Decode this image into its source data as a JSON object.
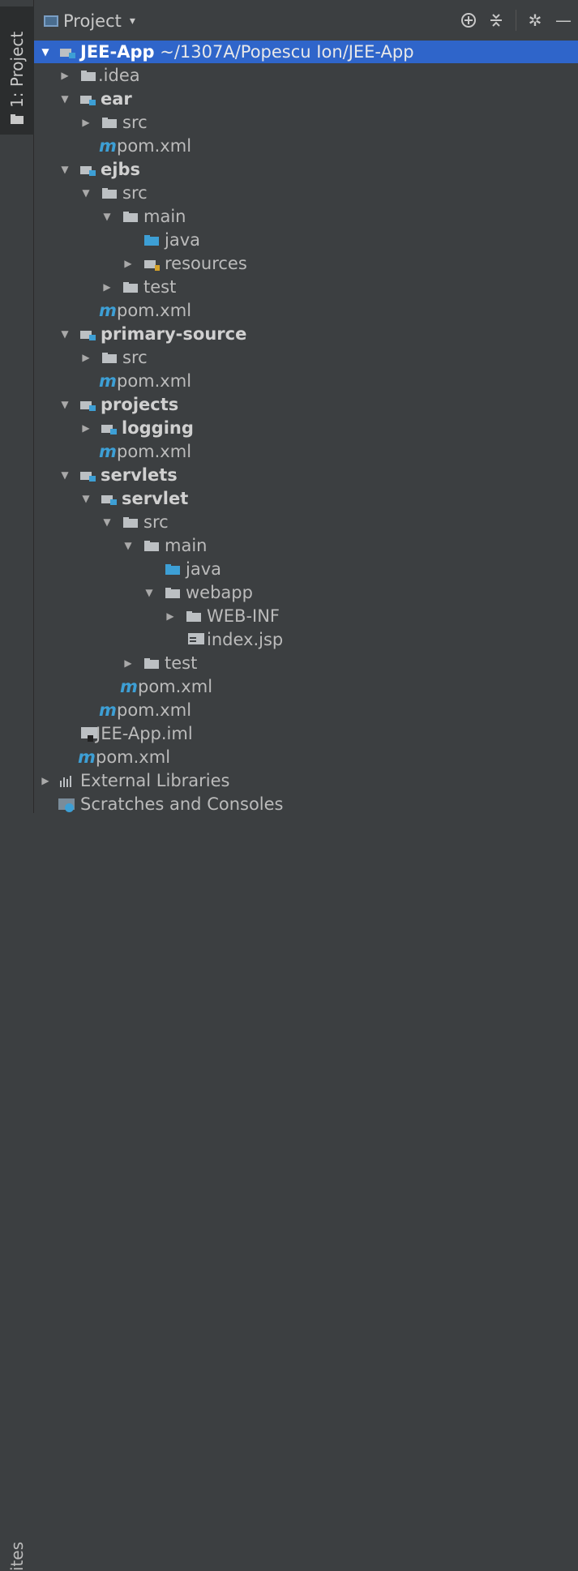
{
  "side": {
    "tab_label": "1: Project",
    "bottom_label": "ites"
  },
  "header": {
    "view_label": "Project",
    "icons": [
      "target-icon",
      "collapse-icon",
      "gear-icon",
      "minimize-icon"
    ]
  },
  "tree": {
    "root_name": "JEE-App",
    "root_path": "~/1307A/Popescu Ion/JEE-App",
    "items": [
      {
        "label": ".idea"
      },
      {
        "label": "ear"
      },
      {
        "label": "src"
      },
      {
        "label": "pom.xml"
      },
      {
        "label": "ejbs"
      },
      {
        "label": "src"
      },
      {
        "label": "main"
      },
      {
        "label": "java"
      },
      {
        "label": "resources"
      },
      {
        "label": "test"
      },
      {
        "label": "pom.xml"
      },
      {
        "label": "primary-source"
      },
      {
        "label": "src"
      },
      {
        "label": "pom.xml"
      },
      {
        "label": "projects"
      },
      {
        "label": "logging"
      },
      {
        "label": "pom.xml"
      },
      {
        "label": "servlets"
      },
      {
        "label": "servlet"
      },
      {
        "label": "src"
      },
      {
        "label": "main"
      },
      {
        "label": "java"
      },
      {
        "label": "webapp"
      },
      {
        "label": "WEB-INF"
      },
      {
        "label": "index.jsp"
      },
      {
        "label": "test"
      },
      {
        "label": "pom.xml"
      },
      {
        "label": "pom.xml"
      },
      {
        "label": "JEE-App.iml"
      },
      {
        "label": "pom.xml"
      },
      {
        "label": "External Libraries"
      },
      {
        "label": "Scratches and Consoles"
      }
    ]
  },
  "maven_glyph": "m",
  "colors": {
    "background": "#3c3f41",
    "selection": "#2f65ca",
    "folder_blue": "#3d9fd5",
    "text": "#bbbbbb"
  }
}
